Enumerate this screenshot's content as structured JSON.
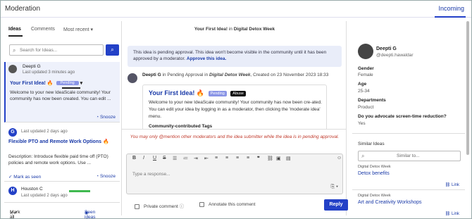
{
  "header": {
    "title": "Moderation",
    "active_tab": "Incoming"
  },
  "subtabs": {
    "ideas": "Ideas",
    "comments": "Comments",
    "sort": "Most recent"
  },
  "search": {
    "placeholder": "Search for Ideas..."
  },
  "cards": [
    {
      "avatar_letter": "",
      "author": "Deepti G",
      "updated": "Last updated 3 minutes ago",
      "title": "Your First Idea!",
      "badge": "Pending",
      "body": "Welcome to your new IdeaScale community! Your community has now been created. You can edit ...",
      "snooze": "Snooze"
    },
    {
      "avatar_letter": "G",
      "author": "",
      "updated": "Last updated 2 days ago",
      "title": "Flexible PTO and Remote Work Options",
      "body": "Description: Introduce flexible paid time off (PTO) policies and remote work options. Use ...",
      "mark_seen": "Mark as seen",
      "snooze": "Snooze"
    },
    {
      "avatar_letter": "H",
      "author": "Houston C",
      "updated": "Last updated 2 days ago"
    }
  ],
  "left_footer": {
    "mark_all": "Mark all as seen",
    "seen_ideas": "Seen ideas"
  },
  "crumb": {
    "idea": "Your First Idea!",
    "in": "in",
    "community": "Digital Detox Week"
  },
  "notice": {
    "text": "This idea is pending approval. This idea won't become visible in the community until it has been approved by a moderator.",
    "link": "Approve this idea."
  },
  "post": {
    "author": "Deepti G",
    "status": "in Pending Approval in",
    "community": "Digital Detox Week",
    "created": ", Created on 23 November 2023 18:33",
    "title": "Your First Idea!",
    "badge_pending": "Pending",
    "badge_abuse": "Abuse",
    "body": "Welcome to your new IdeaScale community! Your community has now been cre-ated. You can edit your idea by logging in as a moderator, then clicking the 'moderate idea' menu.",
    "tags_label": "Community-contributed Tags"
  },
  "mention_note": "You may only @mention other moderators and the idea submitter while the idea is in pending approval.",
  "editor": {
    "placeholder": "Type a response..."
  },
  "options": {
    "private": "Private comment",
    "annotate": "Annotate this comment"
  },
  "reply_label": "Reply",
  "profile": {
    "name": "Deepti G",
    "handle": "@deepti.hawaldar",
    "fields": [
      {
        "label": "Gender",
        "value": "Female"
      },
      {
        "label": "Age",
        "value": "25-34"
      },
      {
        "label": "Departments",
        "value": "Product"
      },
      {
        "label": "Do you advocate screen-time reduction?",
        "value": "Yes"
      }
    ]
  },
  "similar": {
    "title": "Similar Ideas",
    "placeholder": "Similar to...",
    "items": [
      {
        "category": "Digital Detox Week",
        "title": "Detox benefits",
        "link": "Link"
      },
      {
        "category": "Digital Detox Week",
        "title": "Art and Creativity Workshops",
        "link": "Link"
      }
    ]
  },
  "colors": {
    "accent": "#2341c7",
    "link": "#1a3aa8",
    "notice_bg": "#e9edf9",
    "warning": "#c0392b"
  }
}
